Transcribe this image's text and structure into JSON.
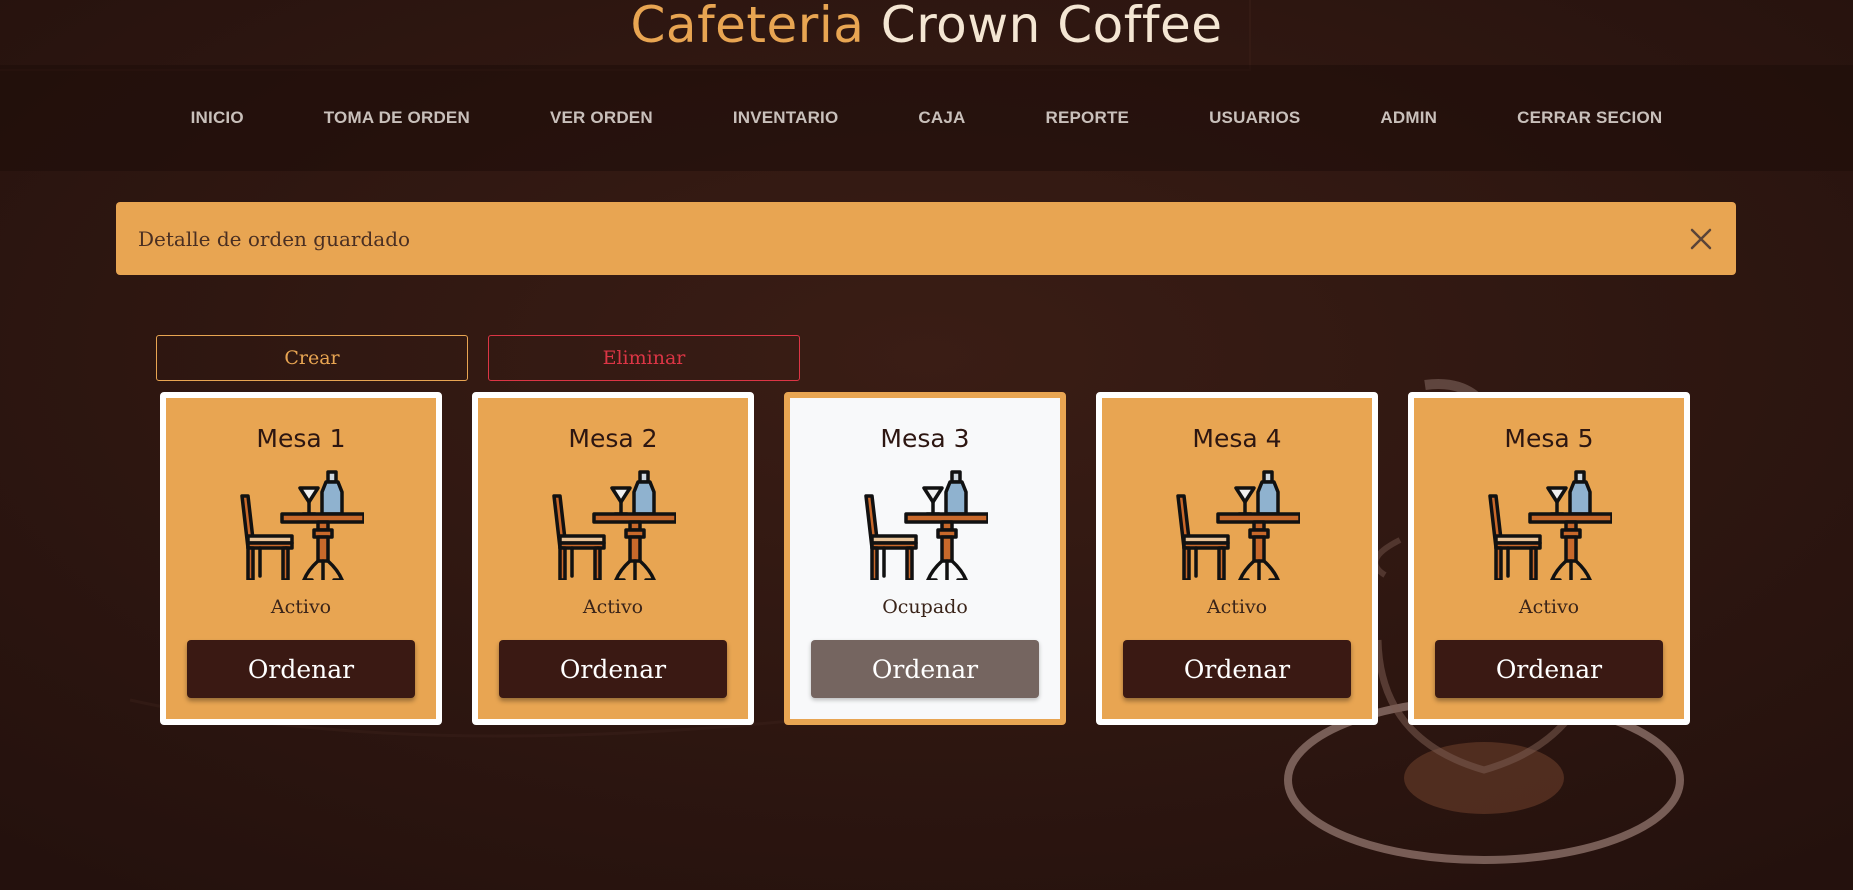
{
  "brand": {
    "part1": "Cafeteria",
    "part2": "Crown Coffee"
  },
  "nav": [
    "INICIO",
    "TOMA DE ORDEN",
    "VER ORDEN",
    "INVENTARIO",
    "CAJA",
    "REPORTE",
    "USUARIOS",
    "ADMIN",
    "CERRAR SECION"
  ],
  "alert": {
    "message": "Detalle de orden guardado",
    "close_icon": "close-icon"
  },
  "actions": {
    "create_label": "Crear",
    "delete_label": "Eliminar"
  },
  "tables": [
    {
      "name": "Mesa 1",
      "status": "Activo",
      "button": "Ordenar",
      "icon": "table-chair-bottle-icon"
    },
    {
      "name": "Mesa 2",
      "status": "Activo",
      "button": "Ordenar",
      "icon": "table-chair-bottle-icon"
    },
    {
      "name": "Mesa 3",
      "status": "Ocupado",
      "button": "Ordenar",
      "icon": "table-chair-bottle-icon"
    },
    {
      "name": "Mesa 4",
      "status": "Activo",
      "button": "Ordenar",
      "icon": "table-chair-bottle-icon"
    },
    {
      "name": "Mesa 5",
      "status": "Activo",
      "button": "Ordenar",
      "icon": "table-chair-bottle-icon"
    }
  ],
  "colors": {
    "background": "#2d1611",
    "accent": "#e8a552",
    "button_dark": "#3a1913",
    "button_disabled": "#756560",
    "danger": "#dc3545"
  }
}
